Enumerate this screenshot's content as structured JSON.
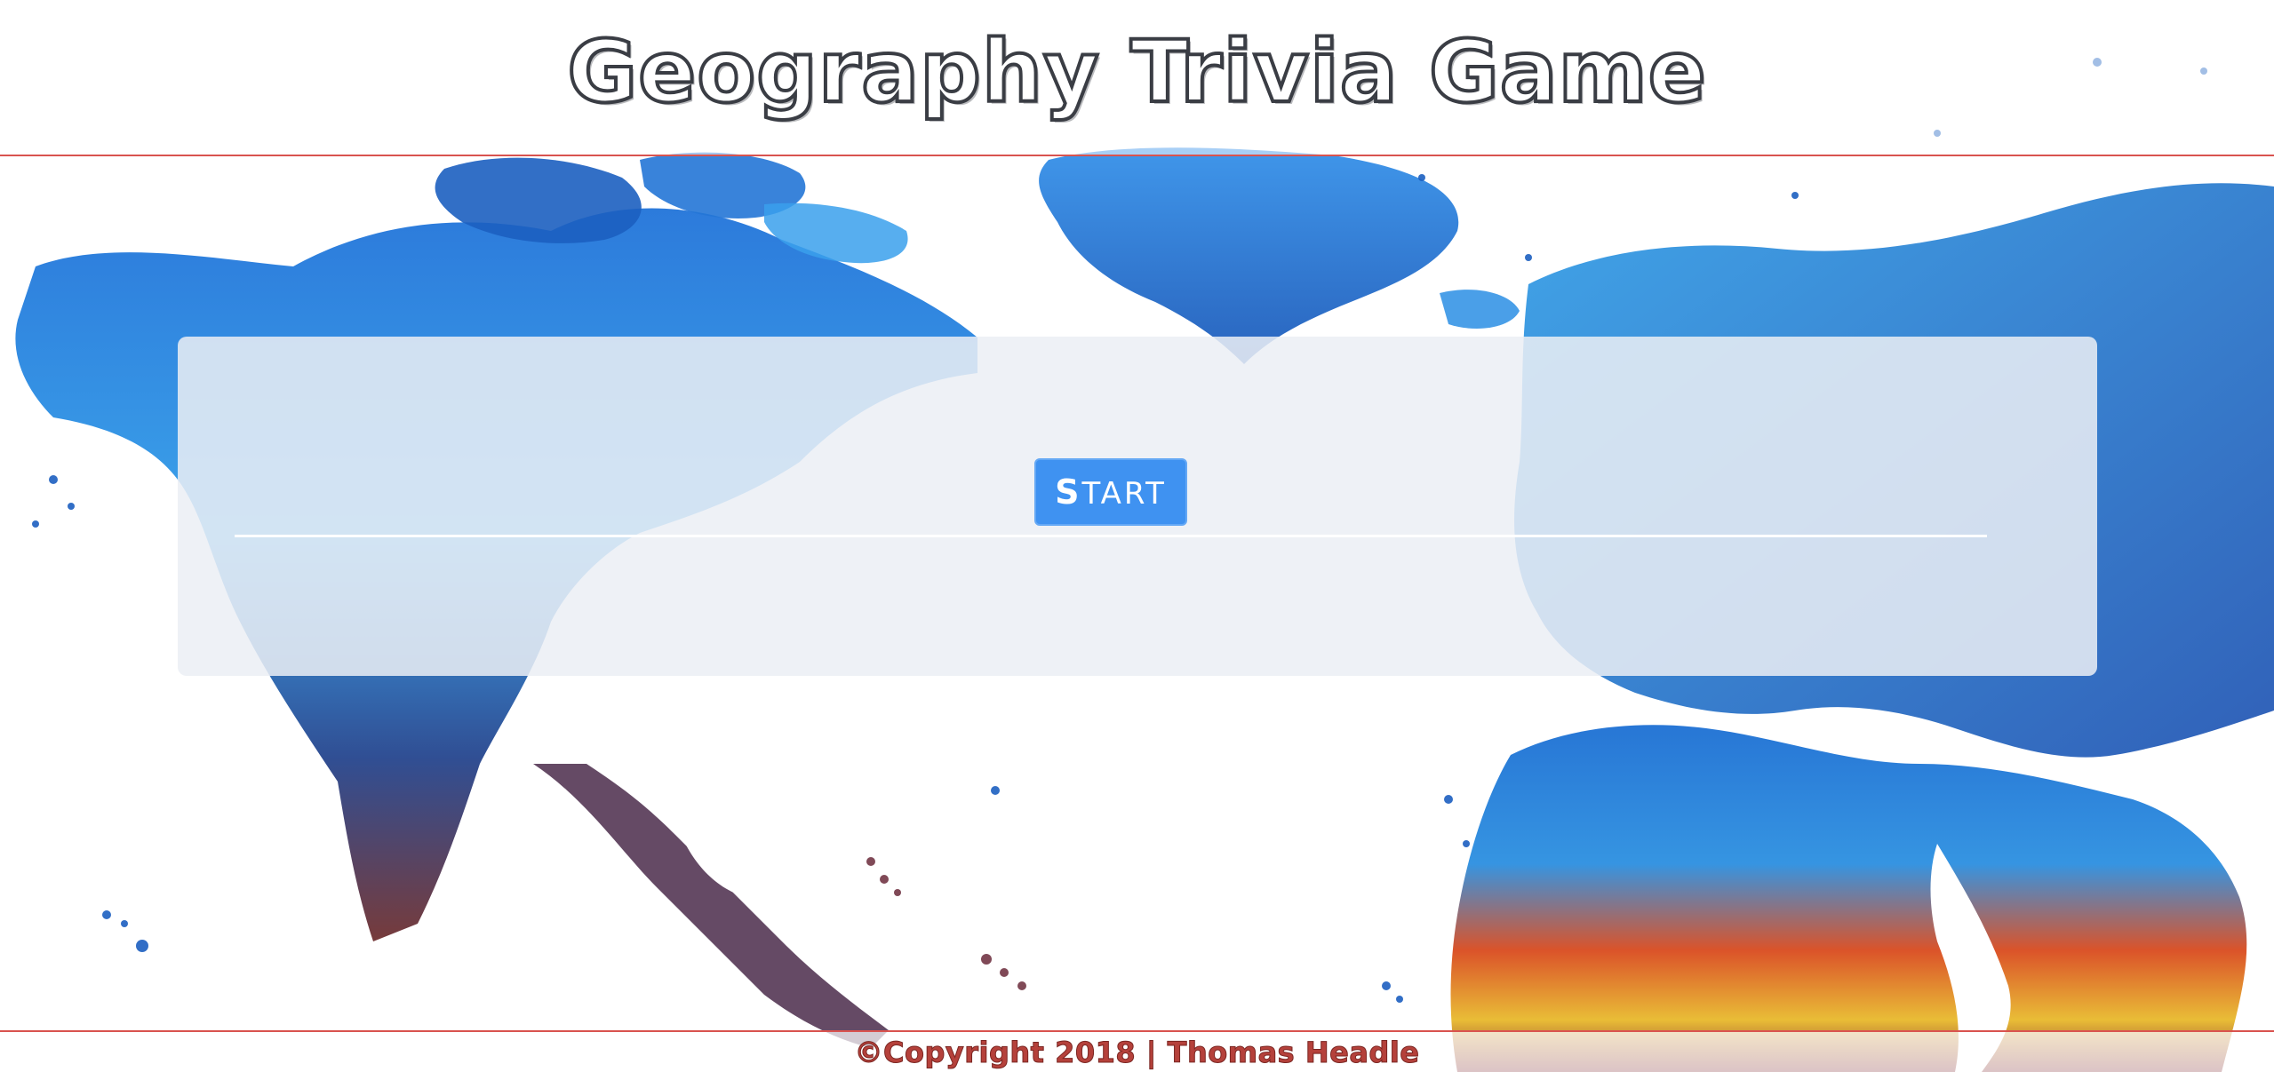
{
  "header": {
    "title": "Geography Trivia Game"
  },
  "game": {
    "start_label": "START"
  },
  "footer": {
    "copyright": "©Copyright 2018 | Thomas Headle"
  },
  "background": {
    "icon": "painted-world-map"
  },
  "colors": {
    "accent_line": "#d9534f",
    "button": "#3f92f1",
    "title_outline": "#3a3d44",
    "footer_text": "#b5413b"
  }
}
